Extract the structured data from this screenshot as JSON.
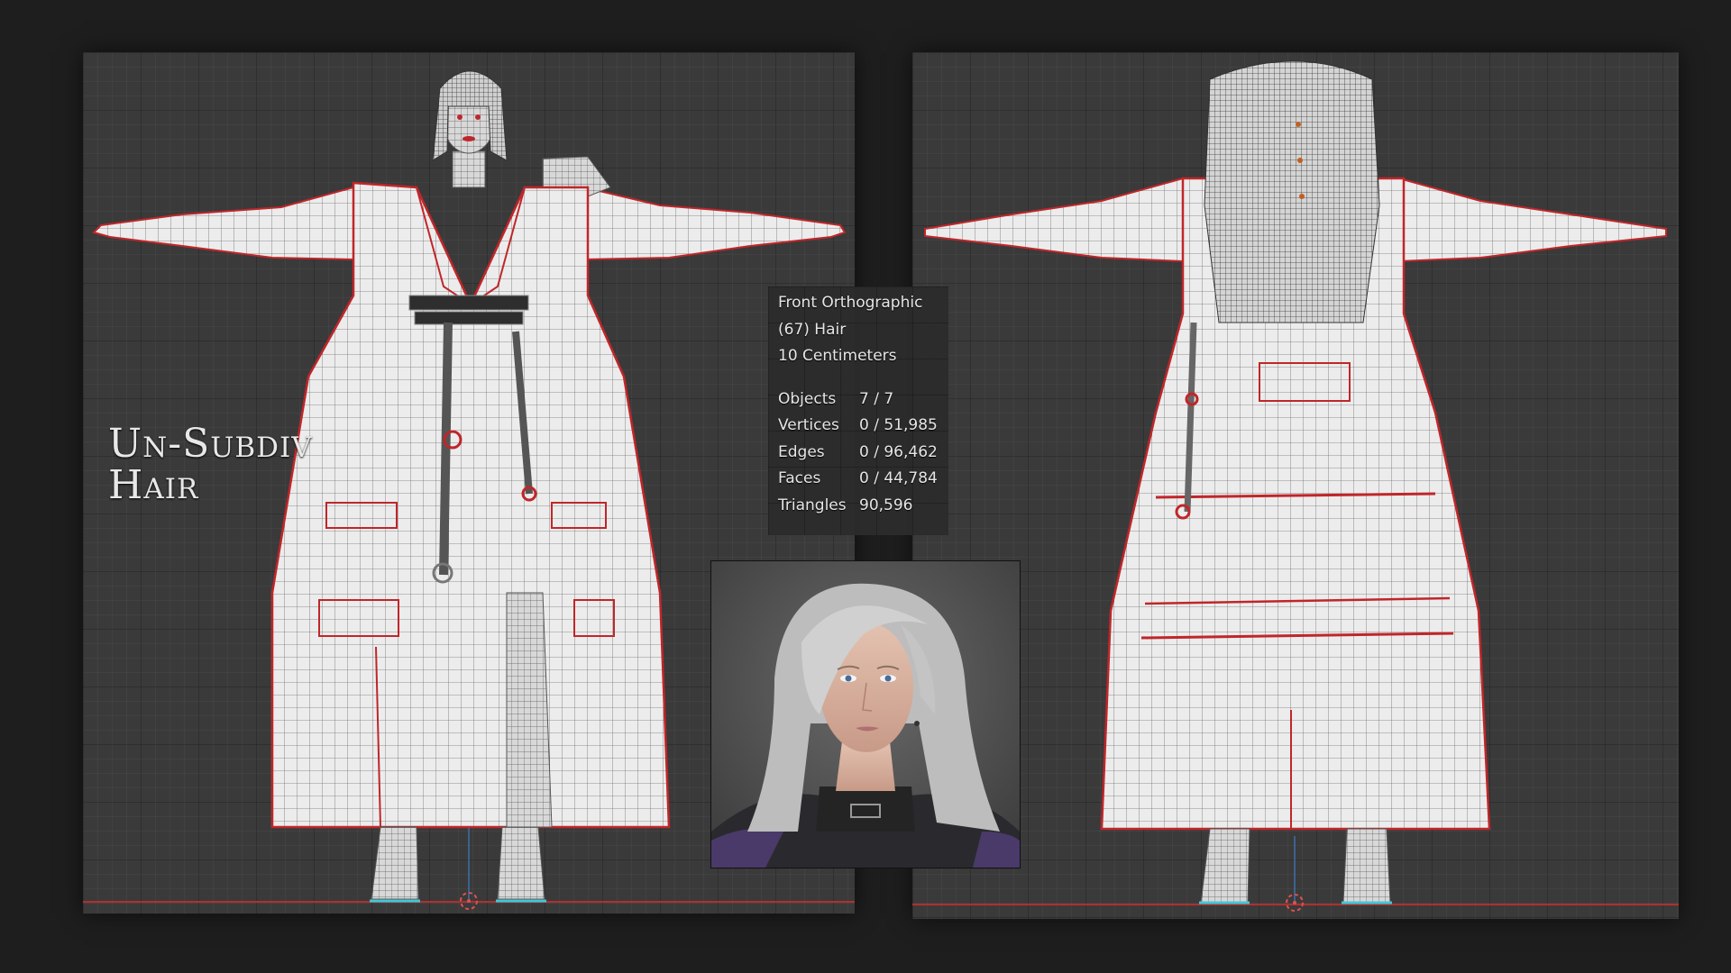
{
  "caption": {
    "line1": "Un-Subdiv",
    "line2": "Hair"
  },
  "overlay": {
    "view": "Front Orthographic",
    "object": "(67) Hair",
    "scale": "10 Centimeters",
    "stats": [
      {
        "label": "Objects",
        "value": "7 / 7"
      },
      {
        "label": "Vertices",
        "value": "0 / 51,985"
      },
      {
        "label": "Edges",
        "value": "0 / 96,462"
      },
      {
        "label": "Faces",
        "value": "0 / 44,784"
      },
      {
        "label": "Triangles",
        "value": "90,596"
      }
    ]
  },
  "colors": {
    "background": "#1e1e1f",
    "viewport": "#3a3a3a",
    "seam_red": "#c0262a",
    "mesh_fill": "#ececec",
    "wire": "#6a6a6a",
    "axis_red": "#b03030",
    "cursor": "#e05050"
  },
  "icons": {
    "cursor": "3d-cursor-icon",
    "origin_axis": "z-axis-line"
  }
}
